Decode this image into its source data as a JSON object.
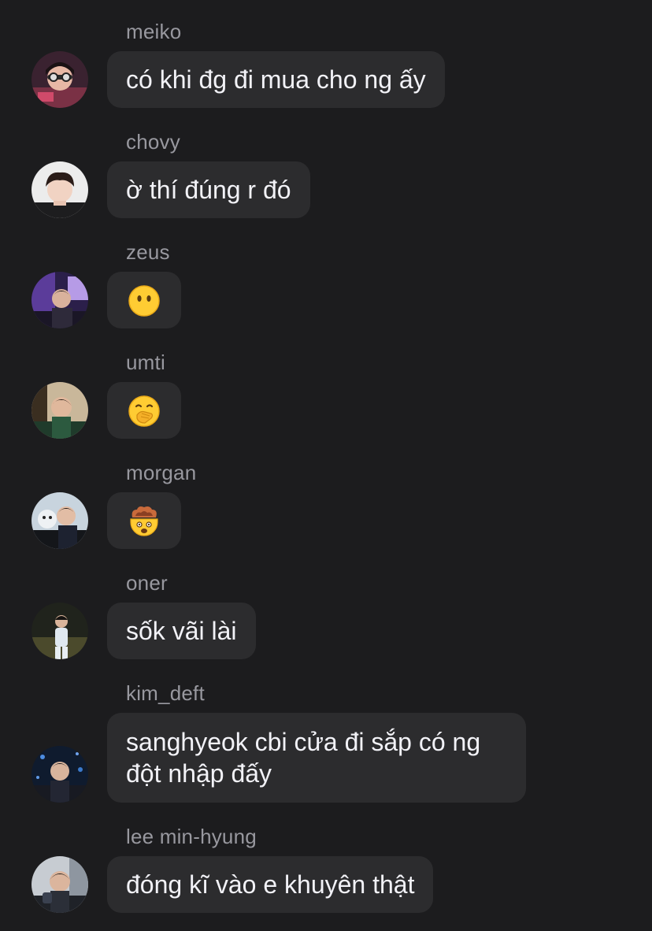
{
  "messages": [
    {
      "sender": "meiko",
      "text": "có khi đg đi mua cho ng ấy"
    },
    {
      "sender": "chovy",
      "text": "ờ thí đúng r đó"
    },
    {
      "sender": "zeus",
      "emoji": "face-without-mouth-icon"
    },
    {
      "sender": "umti",
      "emoji": "face-with-hand-over-mouth-icon"
    },
    {
      "sender": "morgan",
      "emoji": "exploding-head-icon"
    },
    {
      "sender": "oner",
      "text": "sốk vãi lài"
    },
    {
      "sender": "kim_deft",
      "text": "sanghyeok cbi cửa đi sắp có ng đột nhập đấy"
    },
    {
      "sender": "lee min-hyung",
      "text": "đóng kĩ vào e khuyên thật"
    }
  ],
  "theme": {
    "background": "#1c1c1e",
    "bubble": "#2c2c2e",
    "sender_text": "#98989f",
    "message_text": "#f2f2f7"
  }
}
